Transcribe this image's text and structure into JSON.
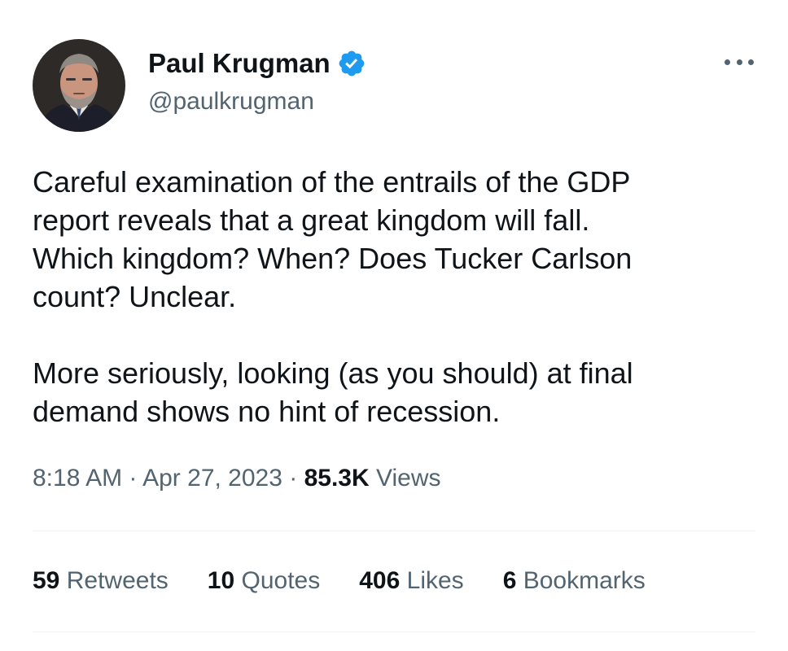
{
  "author": {
    "display_name": "Paul Krugman",
    "handle": "@paulkrugman",
    "verified_icon": "verified-badge-icon",
    "verified_color": "#1d9bf0"
  },
  "tweet": {
    "paragraphs": [
      "Careful examination of the entrails of the GDP\nreport reveals that a great kingdom will fall.\nWhich kingdom? When? Does Tucker Carlson\ncount? Unclear.",
      "More seriously, looking (as you should) at final\ndemand shows no hint of recession."
    ],
    "time": "8:18 AM",
    "separator": "·",
    "date": "Apr 27, 2023",
    "views_count": "85.3K",
    "views_label": "Views"
  },
  "stats": [
    {
      "count": "59",
      "label": "Retweets"
    },
    {
      "count": "10",
      "label": "Quotes"
    },
    {
      "count": "406",
      "label": "Likes"
    },
    {
      "count": "6",
      "label": "Bookmarks"
    }
  ],
  "colors": {
    "text": "#0f1419",
    "secondary": "#536471",
    "divider": "#eff3f4"
  }
}
